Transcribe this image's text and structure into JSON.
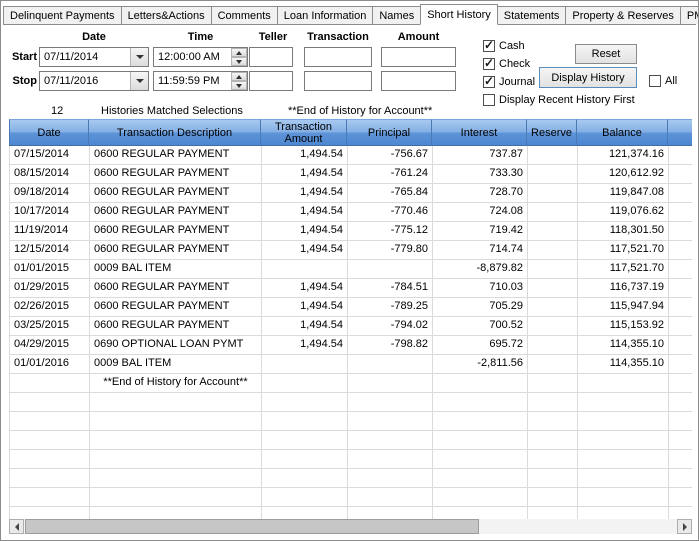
{
  "accent": {
    "grid_header_top": "#a7c9f0",
    "grid_header_bottom": "#4d87d1"
  },
  "tabs": [
    {
      "label": "Delinquent Payments",
      "active": false
    },
    {
      "label": "Letters&Actions",
      "active": false
    },
    {
      "label": "Comments",
      "active": false
    },
    {
      "label": "Loan Information",
      "active": false
    },
    {
      "label": "Names",
      "active": false
    },
    {
      "label": "Short History",
      "active": true
    },
    {
      "label": "Statements",
      "active": false
    },
    {
      "label": "Property & Reserves",
      "active": false
    },
    {
      "label": "PMI",
      "active": false
    }
  ],
  "filters": {
    "column_headers": [
      "Date",
      "Time",
      "Teller",
      "Transaction",
      "Amount"
    ],
    "start_label": "Start",
    "stop_label": "Stop",
    "start": {
      "date": "07/11/2014",
      "time": "12:00:00 AM",
      "teller": "",
      "transaction": "",
      "amount": ""
    },
    "stop": {
      "date": "07/11/2016",
      "time": "11:59:59 PM",
      "teller": "",
      "transaction": "",
      "amount": ""
    },
    "checks": {
      "cash": {
        "label": "Cash",
        "checked": true
      },
      "check": {
        "label": "Check",
        "checked": true
      },
      "journal": {
        "label": "Journal",
        "checked": true
      },
      "all": {
        "label": "All",
        "checked": false
      },
      "recent_first": {
        "label": "Display Recent History First",
        "checked": false
      }
    },
    "buttons": {
      "reset": "Reset",
      "display_history": "Display History"
    }
  },
  "status": {
    "count": "12",
    "matched_text": "Histories Matched Selections",
    "end_text": "**End of History for Account**"
  },
  "grid": {
    "headers": [
      "Date",
      "Transaction Description",
      "Transaction Amount",
      "Principal",
      "Interest",
      "Reserve",
      "Balance"
    ],
    "rows": [
      {
        "cells": [
          "07/15/2014",
          "0600 REGULAR PAYMENT",
          "1,494.54",
          "-756.67",
          "737.87",
          "",
          "121,374.16"
        ]
      },
      {
        "cells": [
          "08/15/2014",
          "0600 REGULAR PAYMENT",
          "1,494.54",
          "-761.24",
          "733.30",
          "",
          "120,612.92"
        ]
      },
      {
        "cells": [
          "09/18/2014",
          "0600 REGULAR PAYMENT",
          "1,494.54",
          "-765.84",
          "728.70",
          "",
          "119,847.08"
        ]
      },
      {
        "cells": [
          "10/17/2014",
          "0600 REGULAR PAYMENT",
          "1,494.54",
          "-770.46",
          "724.08",
          "",
          "119,076.62"
        ]
      },
      {
        "cells": [
          "11/19/2014",
          "0600 REGULAR PAYMENT",
          "1,494.54",
          "-775.12",
          "719.42",
          "",
          "118,301.50"
        ]
      },
      {
        "cells": [
          "12/15/2014",
          "0600 REGULAR PAYMENT",
          "1,494.54",
          "-779.80",
          "714.74",
          "",
          "117,521.70"
        ]
      },
      {
        "cells": [
          "01/01/2015",
          "0009 BAL ITEM",
          "",
          "",
          "-8,879.82",
          "",
          "117,521.70"
        ]
      },
      {
        "cells": [
          "01/29/2015",
          "0600 REGULAR PAYMENT",
          "1,494.54",
          "-784.51",
          "710.03",
          "",
          "116,737.19"
        ]
      },
      {
        "cells": [
          "02/26/2015",
          "0600 REGULAR PAYMENT",
          "1,494.54",
          "-789.25",
          "705.29",
          "",
          "115,947.94"
        ]
      },
      {
        "cells": [
          "03/25/2015",
          "0600 REGULAR PAYMENT",
          "1,494.54",
          "-794.02",
          "700.52",
          "",
          "115,153.92"
        ]
      },
      {
        "cells": [
          "04/29/2015",
          "0690 OPTIONAL LOAN PYMT",
          "1,494.54",
          "-798.82",
          "695.72",
          "",
          "114,355.10"
        ]
      },
      {
        "cells": [
          "01/01/2016",
          "0009 BAL ITEM",
          "",
          "",
          "-2,811.56",
          "",
          "114,355.10"
        ]
      },
      {
        "cells": [
          "",
          "**End of History for Account**",
          "",
          "",
          "",
          "",
          ""
        ],
        "center_description": true
      }
    ],
    "empty_row_count": 7
  }
}
